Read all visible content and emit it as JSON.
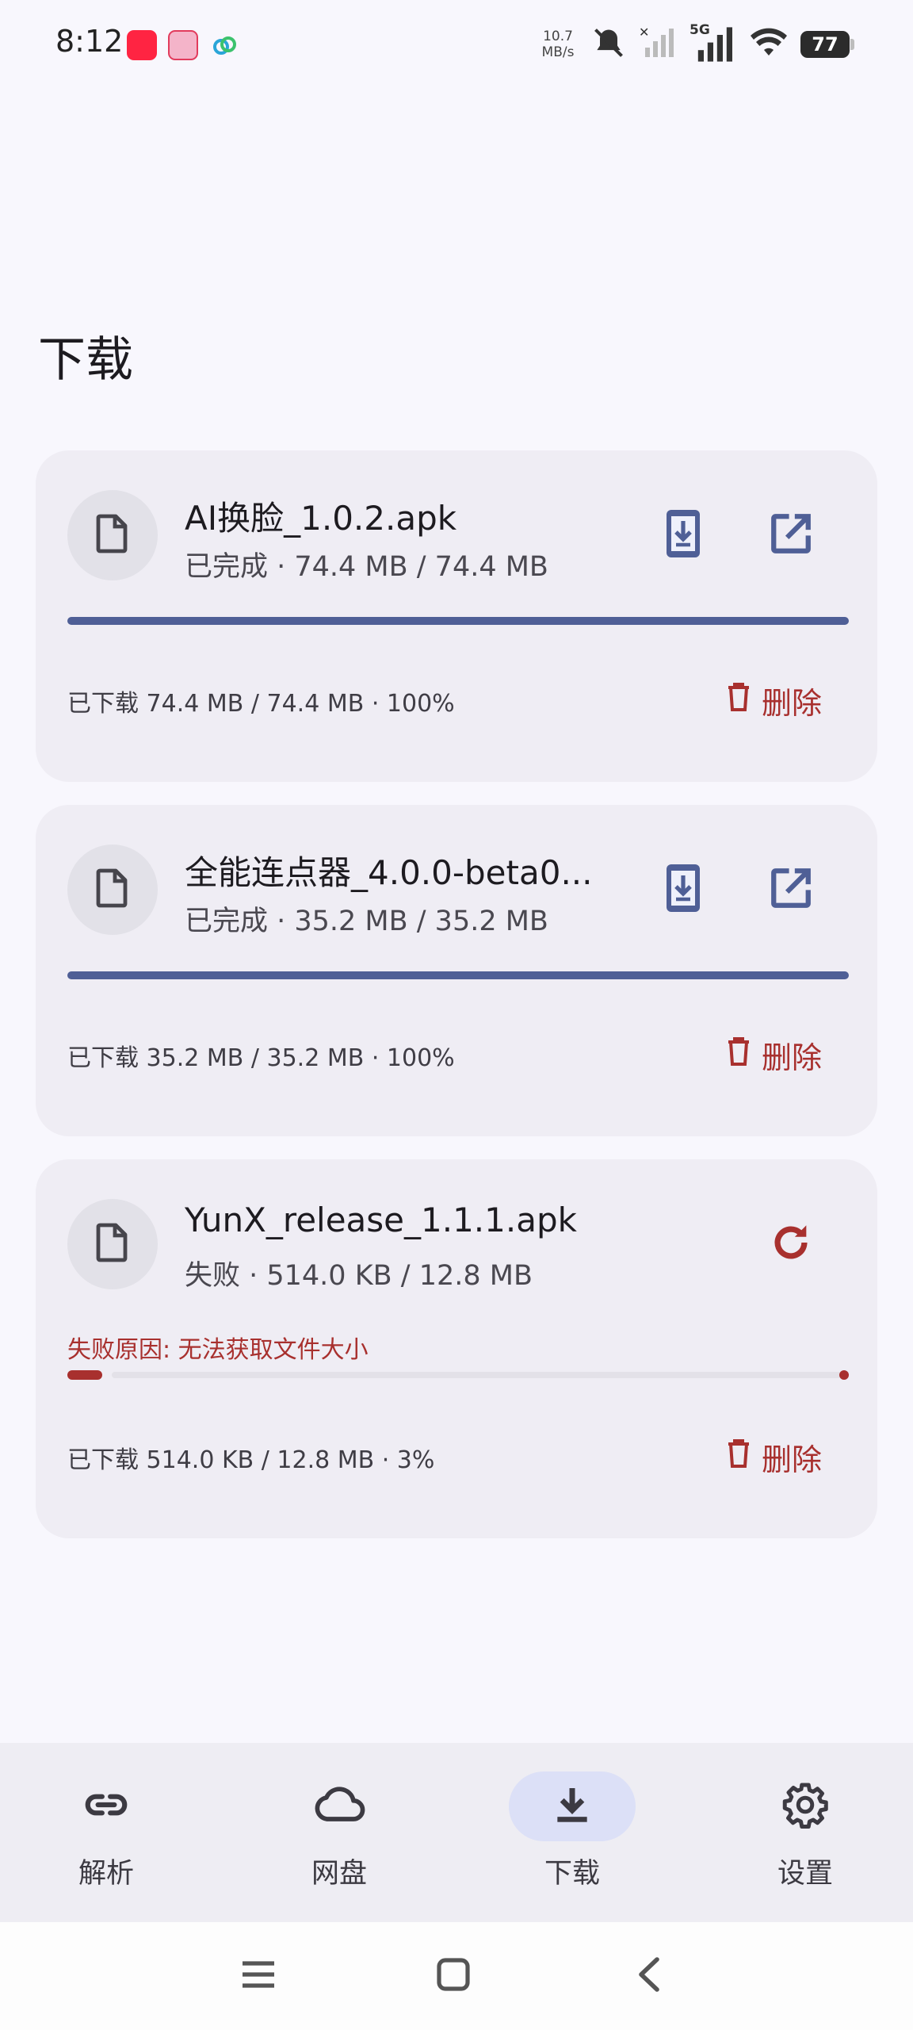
{
  "status_bar": {
    "time": "8:12",
    "net_speed_value": "10.7",
    "net_speed_unit": "MB/s",
    "network_type": "5G",
    "battery": "77"
  },
  "page": {
    "title": "下载"
  },
  "downloads": [
    {
      "file_name": "AI换脸_1.0.2.apk",
      "status_line": "已完成 · 74.4 MB / 74.4 MB",
      "progress_percent": 100,
      "downloaded_line": "已下载 74.4 MB / 74.4 MB · 100%",
      "delete_label": "删除",
      "state": "completed"
    },
    {
      "file_name": "全能连点器_4.0.0-beta0...",
      "status_line": "已完成 · 35.2 MB / 35.2 MB",
      "progress_percent": 100,
      "downloaded_line": "已下载 35.2 MB / 35.2 MB · 100%",
      "delete_label": "删除",
      "state": "completed"
    },
    {
      "file_name": "YunX_release_1.1.1.apk",
      "status_line": "失败 · 514.0 KB / 12.8 MB",
      "error_text": "失败原因: 无法获取文件大小",
      "progress_percent": 3,
      "downloaded_line": "已下载 514.0 KB / 12.8 MB · 3%",
      "delete_label": "删除",
      "state": "failed"
    }
  ],
  "bottom_nav": {
    "items": [
      {
        "label": "解析",
        "icon": "link-icon"
      },
      {
        "label": "网盘",
        "icon": "cloud-icon"
      },
      {
        "label": "下载",
        "icon": "download-icon",
        "active": true
      },
      {
        "label": "设置",
        "icon": "gear-icon"
      }
    ]
  },
  "colors": {
    "accent": "#4f5f96",
    "error": "#a8302e",
    "card_bg": "#efedf4",
    "page_bg": "#f8f7fd",
    "nav_active_pill": "#dce0f7"
  }
}
